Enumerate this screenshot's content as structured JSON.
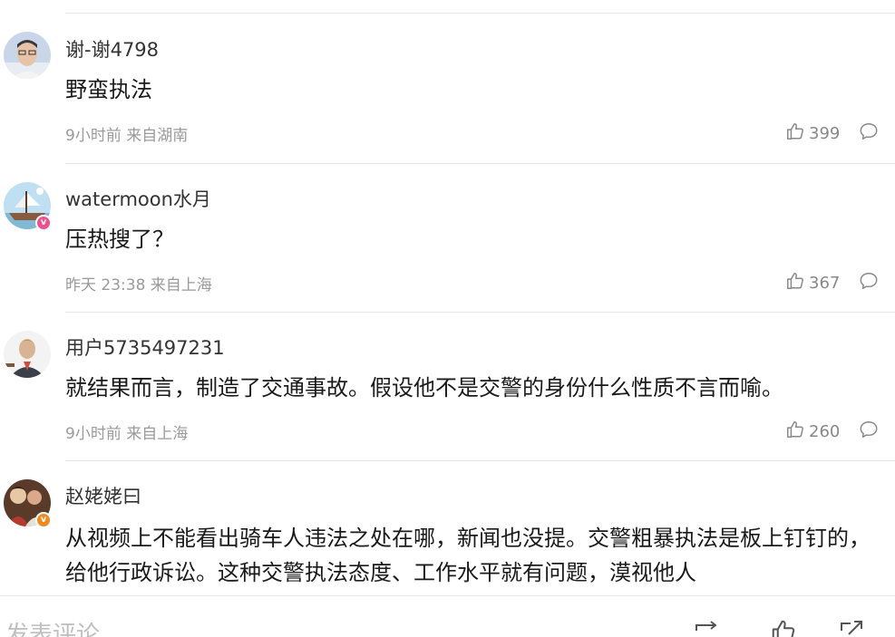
{
  "comments": [
    {
      "username": "谢-谢4798",
      "content": "野蛮执法",
      "meta": "9小时前 来自湖南",
      "likes": "399",
      "avatar": "avatar-man-glasses",
      "badge": null
    },
    {
      "username": "watermoon水月",
      "content": "压热搜了？",
      "meta": "昨天 23:38 来自上海",
      "likes": "367",
      "avatar": "avatar-ship",
      "badge": {
        "letter": "v",
        "color": "#f0508f"
      }
    },
    {
      "username": "用户5735497231",
      "content": "就结果而言，制造了交通事故。假设他不是交警的身份什么性质不言而喻。",
      "meta": "9小时前 来自上海",
      "likes": "260",
      "avatar": "avatar-man-suit",
      "badge": null
    },
    {
      "username": "赵姥姥曰",
      "content": "从视频上不能看出骑车人违法之处在哪，新闻也没提。交警粗暴执法是板上钉钉的，给他行政诉讼。这种交警执法态度、工作水平就有问题，漠视他人",
      "meta": "",
      "likes": "",
      "avatar": "avatar-painting",
      "badge": {
        "letter": "v",
        "color": "#f08a1c"
      }
    }
  ],
  "bottom_bar": {
    "compose_placeholder": "发表评论"
  },
  "colors": {
    "divider": "#e6e6e6",
    "meta_text": "#9a9a9a",
    "icon_gray": "#888888"
  }
}
